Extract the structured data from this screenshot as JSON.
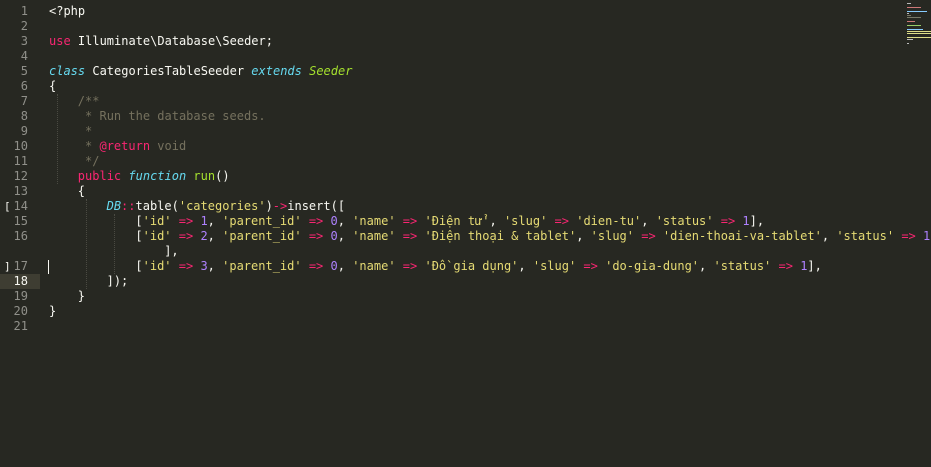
{
  "editor": {
    "theme_colors": {
      "background": "#272822",
      "foreground": "#f8f8f2",
      "comment": "#75715e",
      "keyword": "#f92672",
      "string": "#e6db74",
      "number": "#ae81ff",
      "function": "#a6e22e",
      "storage": "#66d9ef"
    },
    "line_numbers": [
      "1",
      "2",
      "3",
      "4",
      "5",
      "6",
      "7",
      "8",
      "9",
      "10",
      "11",
      "12",
      "13",
      "14",
      "15",
      "16",
      "",
      "17",
      "18",
      "19",
      "20",
      "21"
    ],
    "current_line": "18",
    "fold_markers": [
      "[",
      "]"
    ],
    "code": {
      "l1": "<?php",
      "l3_use": "use",
      "l3_ns": " Illuminate\\Database\\Seeder;",
      "l5_class": "class",
      "l5_name": " CategoriesTableSeeder ",
      "l5_extends": "extends",
      "l5_sp": " ",
      "l5_parent": "Seeder",
      "l6": "{",
      "l7": "/**",
      "l8": " * Run the database seeds.",
      "l9": " *",
      "l10_star": " * ",
      "l10_tag": "@return",
      "l10_type": " void",
      "l11": " */",
      "l12_public": "public",
      "l12_function": "function",
      "l12_name": "run",
      "l12_paren": "()",
      "l13": "{",
      "l14_db": "DB",
      "l14_sep": "::",
      "l14_table": "table(",
      "l14_str": "'categories'",
      "l14_close": ")",
      "l14_arrow": "->",
      "l14_insert": "insert([",
      "rows": [
        {
          "id": "1",
          "parent_id": "0",
          "name": "'Điện tử'",
          "slug": "'dien-tu'",
          "status": "1",
          "tail": "],"
        },
        {
          "id": "2",
          "parent_id": "0",
          "name": "'Điện thoại & tablet'",
          "slug": "'dien-thoai-va-tablet'",
          "status": "1",
          "tail": ""
        },
        {
          "id": "3",
          "parent_id": "0",
          "name": "'Đồ gia dụng'",
          "slug": "'do-gia-dung'",
          "status": "1",
          "tail": "],"
        }
      ],
      "l16_wrap": "],",
      "l18": "]);",
      "l19": "}",
      "l20": "}",
      "keys": {
        "id": "'id'",
        "parent_id": "'parent_id'",
        "name": "'name'",
        "slug": "'slug'",
        "status": "'status'"
      },
      "fat_arrow": "=>",
      "comma": ", ",
      "open_bracket": "["
    }
  }
}
